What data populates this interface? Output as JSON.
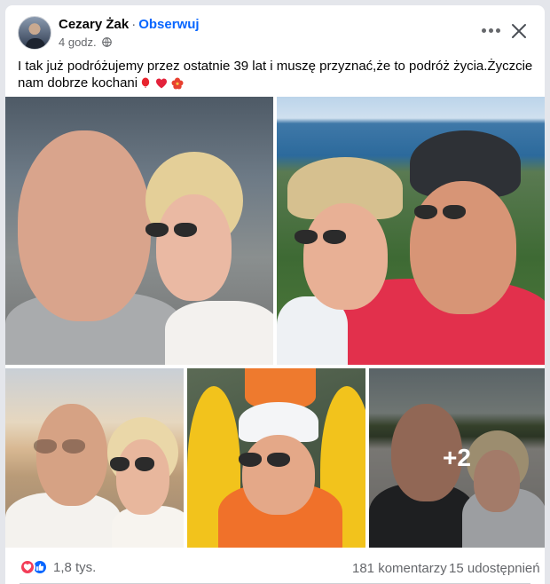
{
  "post": {
    "author": "Cezary Żak",
    "separator": "·",
    "follow_label": "Obserwuj",
    "time": "4 godz.",
    "privacy_icon": "globe-icon",
    "text": "I tak już podróżujemy przez ostatnie 39 lat i muszę przyznać,że to podróż życia.Życzcie nam dobrze kochani",
    "emojis": [
      "balloon-emoji",
      "heart-emoji",
      "hibiscus-emoji"
    ]
  },
  "header_actions": {
    "more_icon": "more-horizontal-icon",
    "close_icon": "close-icon"
  },
  "photos": {
    "more_overlay": "+2"
  },
  "stats": {
    "reaction_icons": [
      "love-reaction-icon",
      "like-reaction-icon"
    ],
    "reaction_count": "1,8 tys.",
    "comments": "181 komentarzy",
    "shares": "15 udostępnień"
  },
  "colors": {
    "accent": "#0866ff",
    "secondary_text": "#65676b",
    "love": "#f33e58"
  }
}
